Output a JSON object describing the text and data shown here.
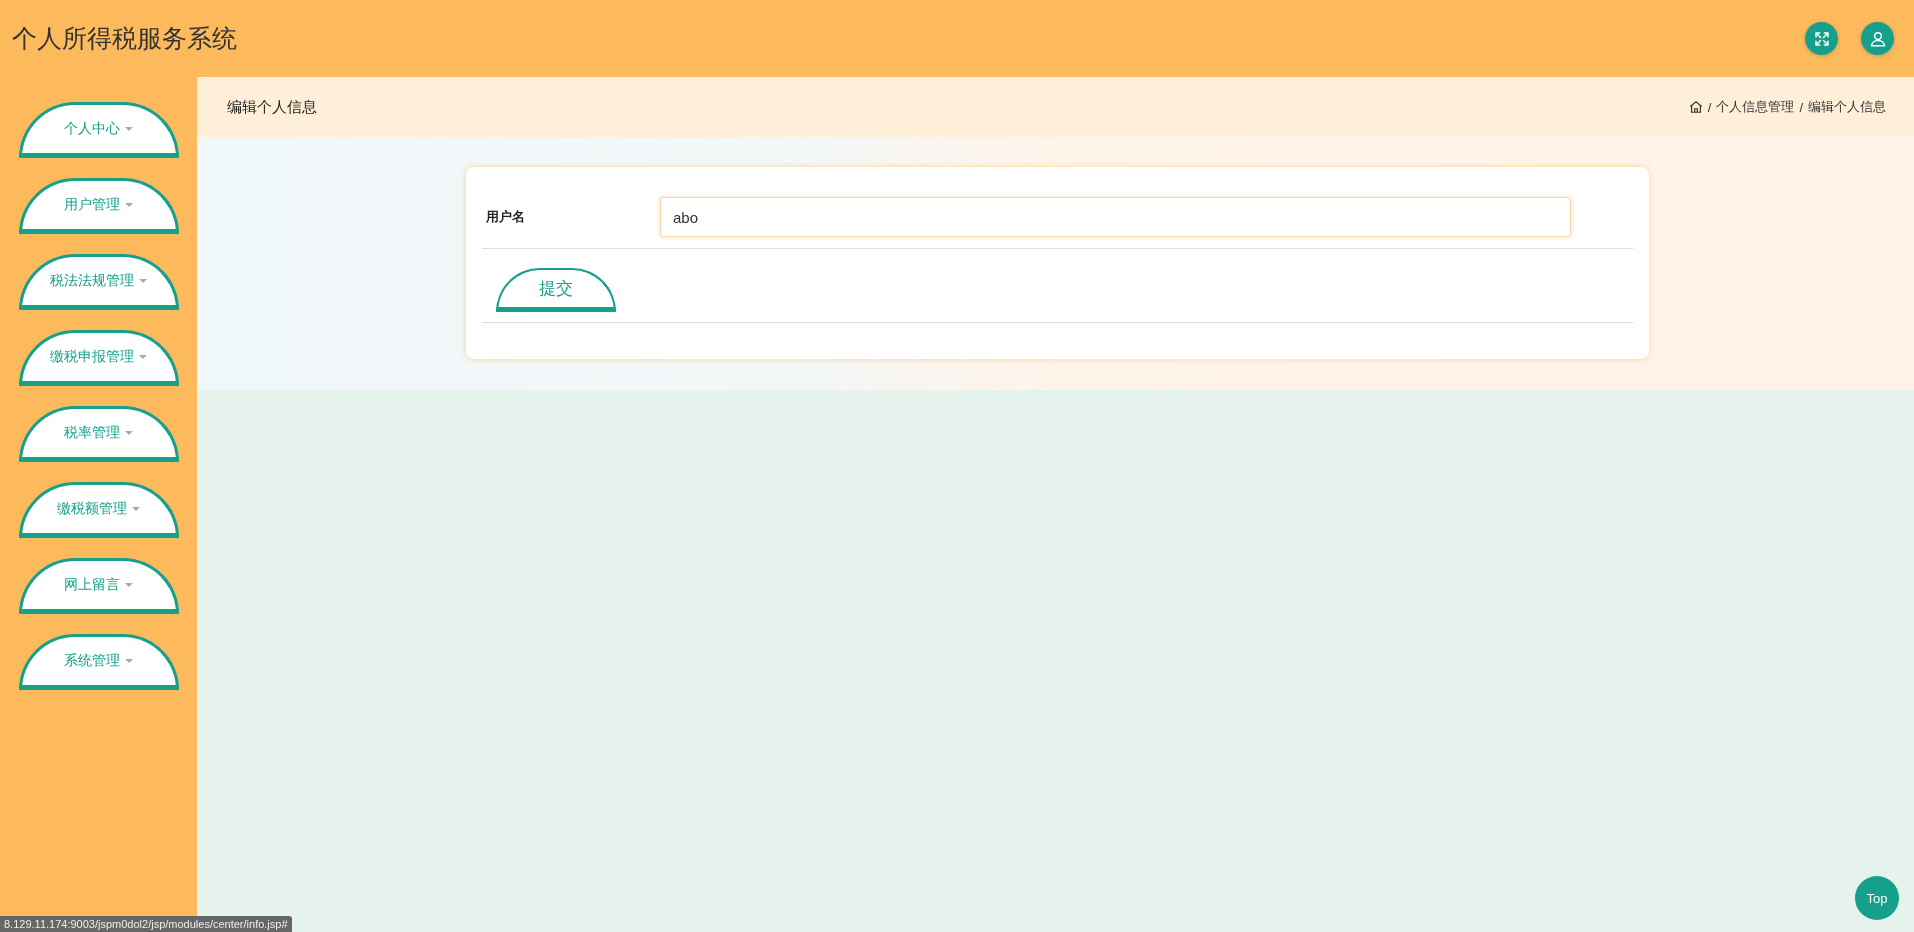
{
  "header": {
    "title": "个人所得税服务系统"
  },
  "sidebar": {
    "items": [
      {
        "label": "个人中心"
      },
      {
        "label": "用户管理"
      },
      {
        "label": "税法法规管理"
      },
      {
        "label": "缴税申报管理"
      },
      {
        "label": "税率管理"
      },
      {
        "label": "缴税额管理"
      },
      {
        "label": "网上留言"
      },
      {
        "label": "系统管理"
      }
    ]
  },
  "page_title": "编辑个人信息",
  "breadcrumb": [
    {
      "separator": "/",
      "label": "个人信息管理"
    },
    {
      "separator": "/",
      "label": "编辑个人信息"
    }
  ],
  "form": {
    "fields": [
      {
        "label": "用户名",
        "value": "abo"
      }
    ],
    "submit": "提交"
  },
  "back_to_top": "Top",
  "status_bar": "8.129.11.174:9003/jspm0dol2/jsp/modules/center/info.jsp#"
}
